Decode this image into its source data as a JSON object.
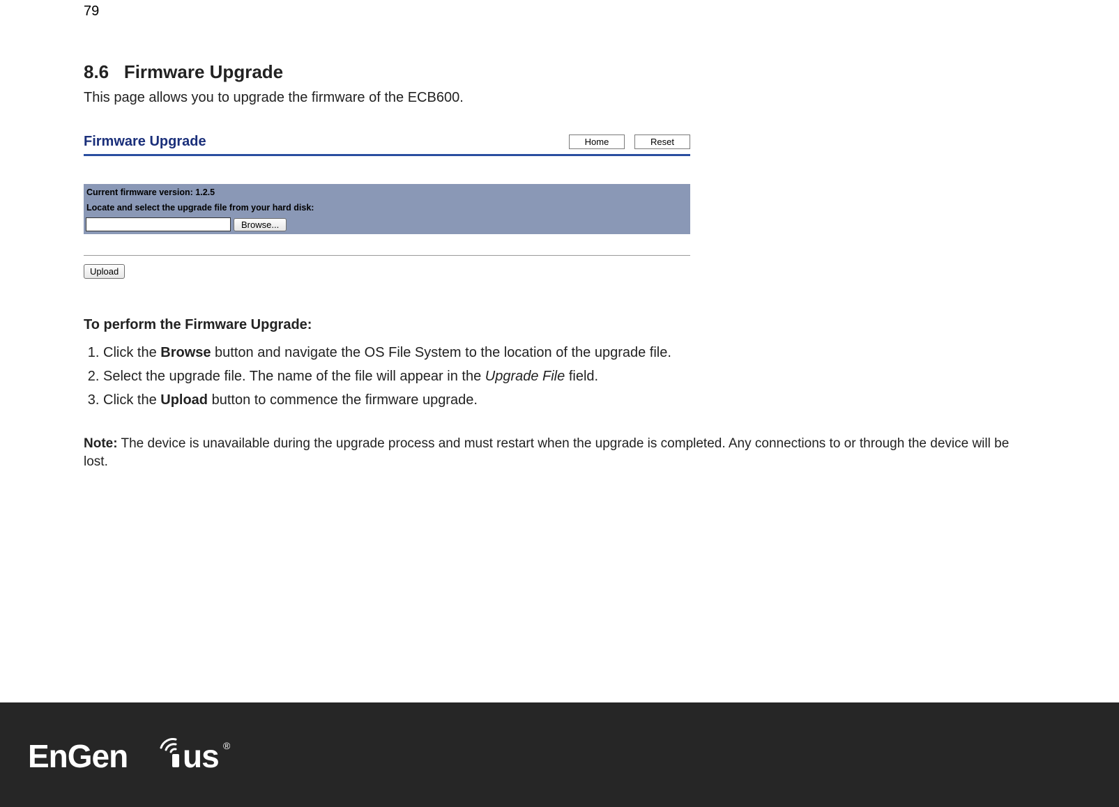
{
  "page_number": "79",
  "section": {
    "number": "8.6",
    "title": "Firmware Upgrade",
    "intro": "This page allows you to upgrade the firmware of the ECB600."
  },
  "panel": {
    "title": "Firmware Upgrade",
    "home_label": "Home",
    "reset_label": "Reset",
    "current_version": "Current firmware version: 1.2.5",
    "locate_text": "Locate and select the upgrade file from your hard disk:",
    "browse_label": "Browse...",
    "upload_label": "Upload"
  },
  "instructions": {
    "heading": "To perform the Firmware Upgrade:",
    "step1_a": "Click the ",
    "step1_b": "Browse",
    "step1_c": " button and navigate the OS File System to the location of the upgrade file.",
    "step2_a": "Select the upgrade file. The name of the file will appear in the ",
    "step2_b": "Upgrade File",
    "step2_c": " field.",
    "step3_a": "Click the ",
    "step3_b": "Upload",
    "step3_c": " button to commence the firmware upgrade."
  },
  "note": {
    "label": "Note:",
    "text": " The device is unavailable during the upgrade process and must restart when the upgrade is completed. Any connections to or through the device will be lost."
  },
  "footer": {
    "brand": "EnGenius"
  }
}
